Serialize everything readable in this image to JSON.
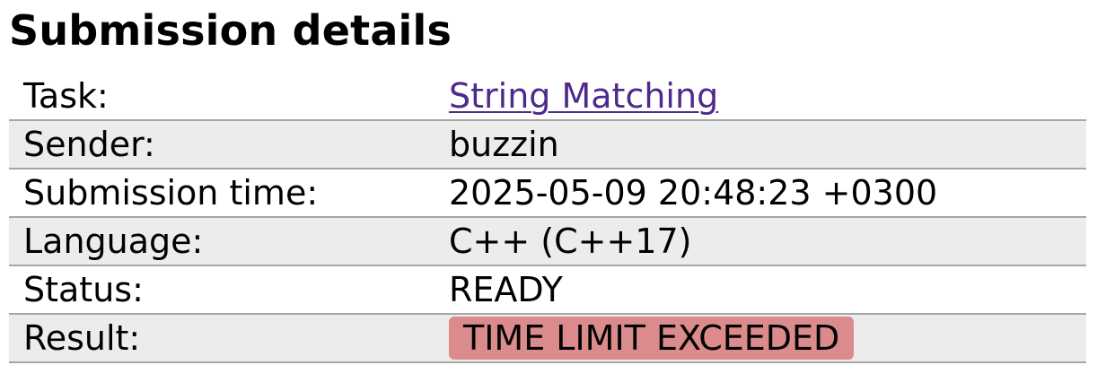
{
  "page": {
    "title": "Submission details"
  },
  "details": {
    "rows": [
      {
        "label": "Task:",
        "value": "String Matching"
      },
      {
        "label": "Sender:",
        "value": "buzzin"
      },
      {
        "label": "Submission time:",
        "value": "2025-05-09 20:48:23 +0300"
      },
      {
        "label": "Language:",
        "value": "C++ (C++17)"
      },
      {
        "label": "Status:",
        "value": "READY"
      },
      {
        "label": "Result:",
        "value": "TIME LIMIT EXCEEDED"
      }
    ]
  },
  "colors": {
    "link": "#4f2a8c",
    "result_badge_background": "#db8b8b",
    "alternate_row_background": "#ececec",
    "row_border": "#a6a6a6"
  }
}
